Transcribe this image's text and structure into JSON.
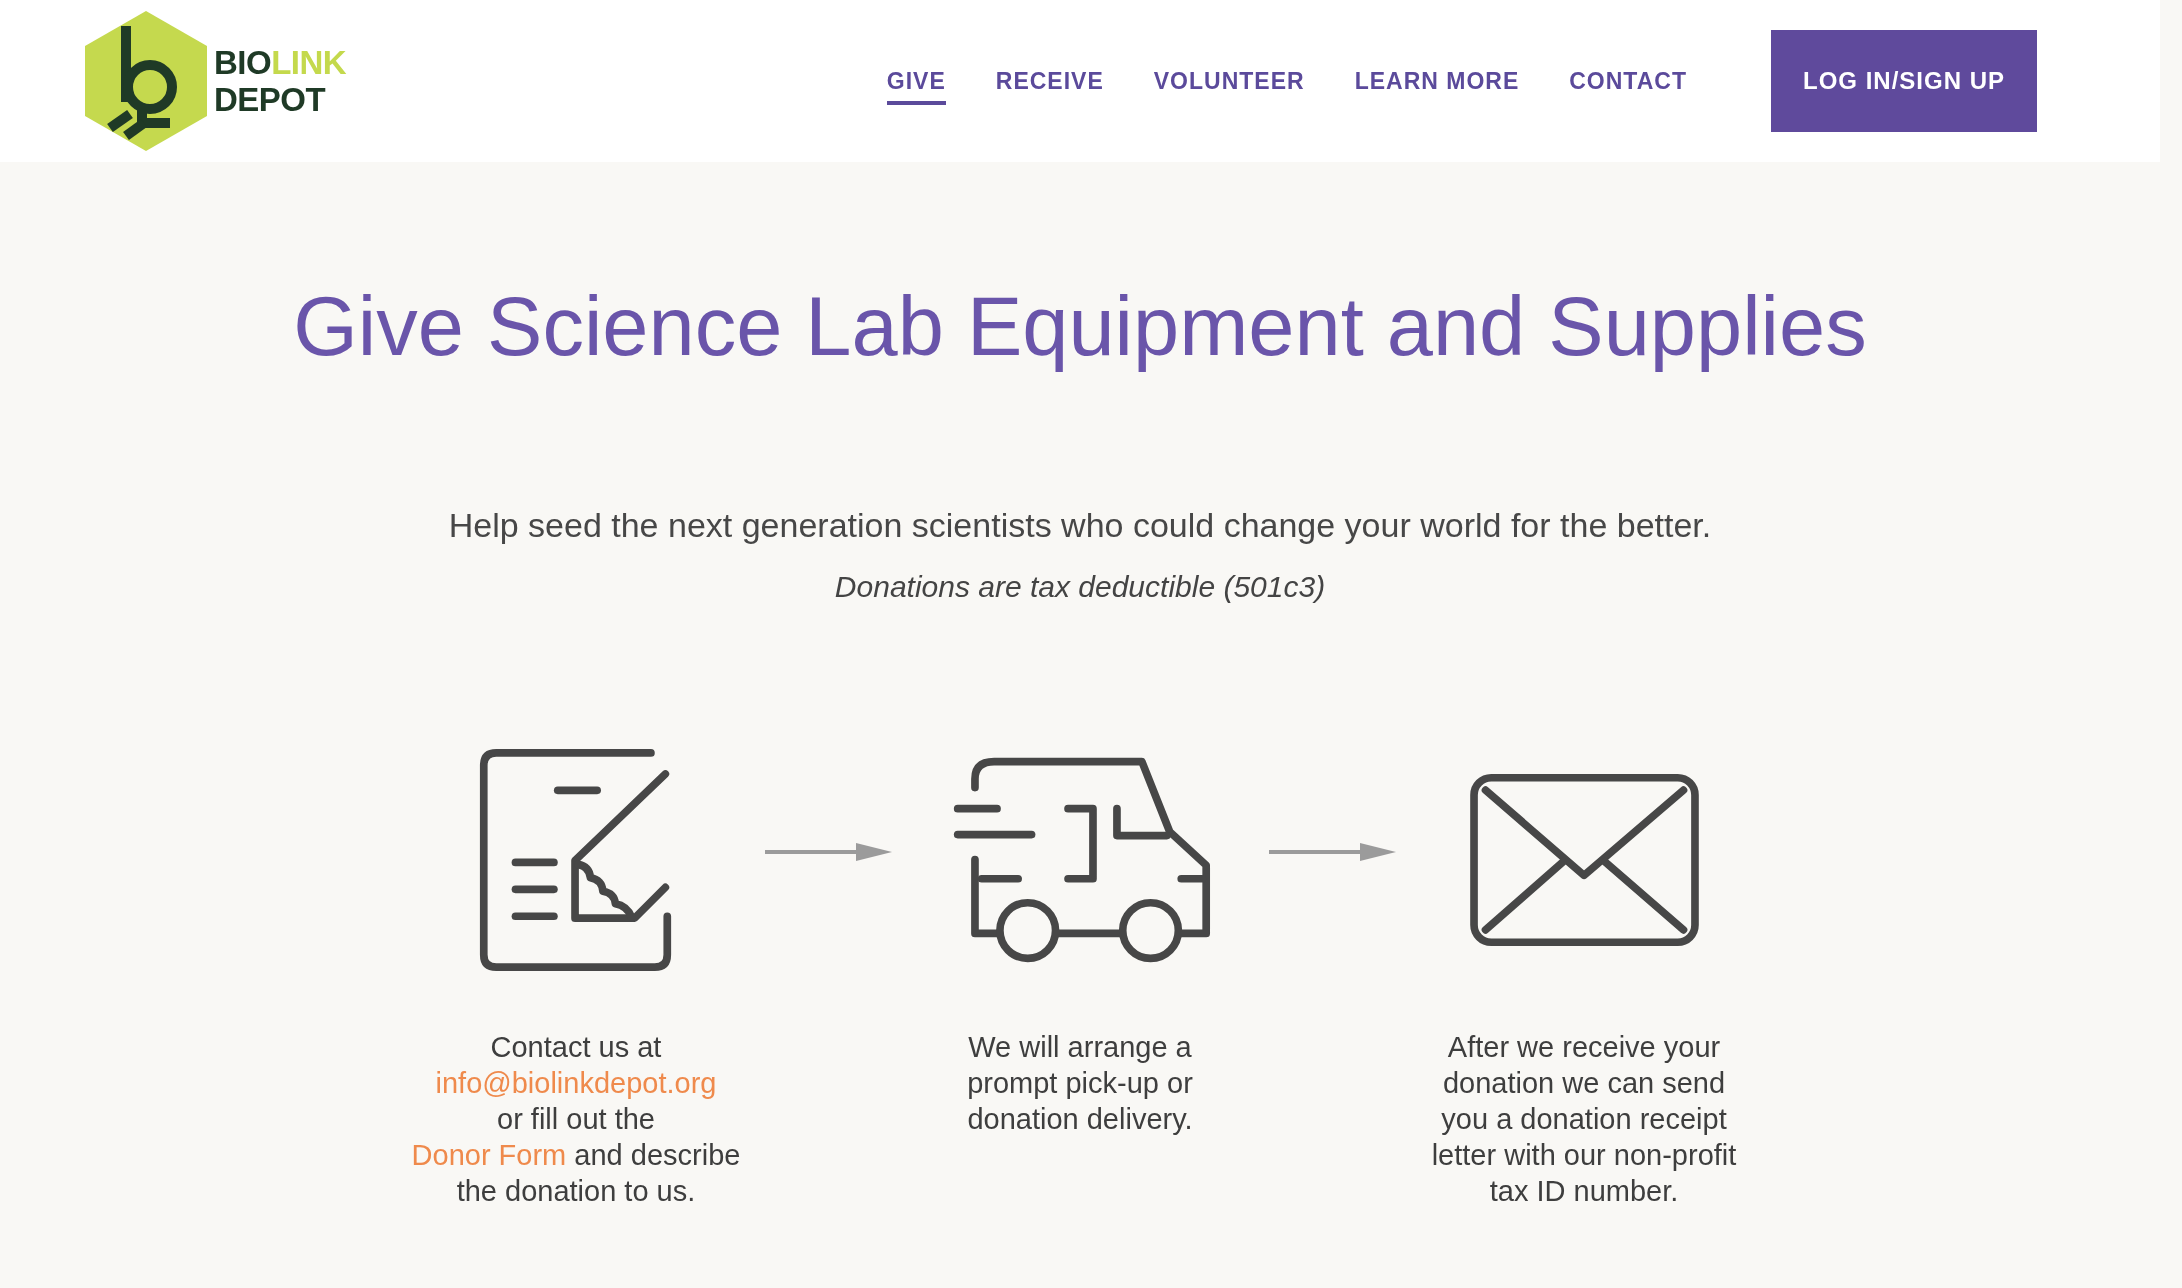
{
  "logo": {
    "lines": [
      [
        {
          "text": "BIO",
          "color": "#1f3a26"
        },
        {
          "text": "LINK",
          "color": "#c4d94c"
        }
      ],
      [
        {
          "text": "DEPOT",
          "color": "#1f3a26"
        }
      ]
    ]
  },
  "nav": [
    {
      "label": "GIVE",
      "selected": true
    },
    {
      "label": "RECEIVE",
      "selected": false
    },
    {
      "label": "VOLUNTEER",
      "selected": false
    },
    {
      "label": "LEARN MORE",
      "selected": false
    },
    {
      "label": "CONTACT",
      "selected": false
    }
  ],
  "login_button": "LOG IN/SIGN UP",
  "heading": "Give Science Lab Equipment and Supplies",
  "intro": "Help seed the next generation scientists who could change your world for the better.",
  "note": "Donations are tax deductible (501c3)",
  "steps": [
    {
      "kind": "form",
      "text": [
        {
          "kind": "text",
          "text": "Contact us at\n"
        },
        {
          "kind": "link",
          "text": "info@biolinkdepot.org"
        },
        {
          "kind": "text",
          "text": "\nor fill out the\n"
        },
        {
          "kind": "link",
          "text": "Donor Form"
        },
        {
          "kind": "text",
          "text": " and describe\nthe donation to us."
        }
      ]
    },
    {
      "kind": "delivery",
      "text": [
        {
          "kind": "text",
          "text": "We will arrange a\nprompt pick-up or\ndonation delivery."
        }
      ]
    },
    {
      "kind": "mail",
      "text": [
        {
          "kind": "text",
          "text": "After we receive your\ndonation we can send\nyou a donation receipt\nletter with our non-profit\ntax ID number."
        }
      ]
    }
  ]
}
